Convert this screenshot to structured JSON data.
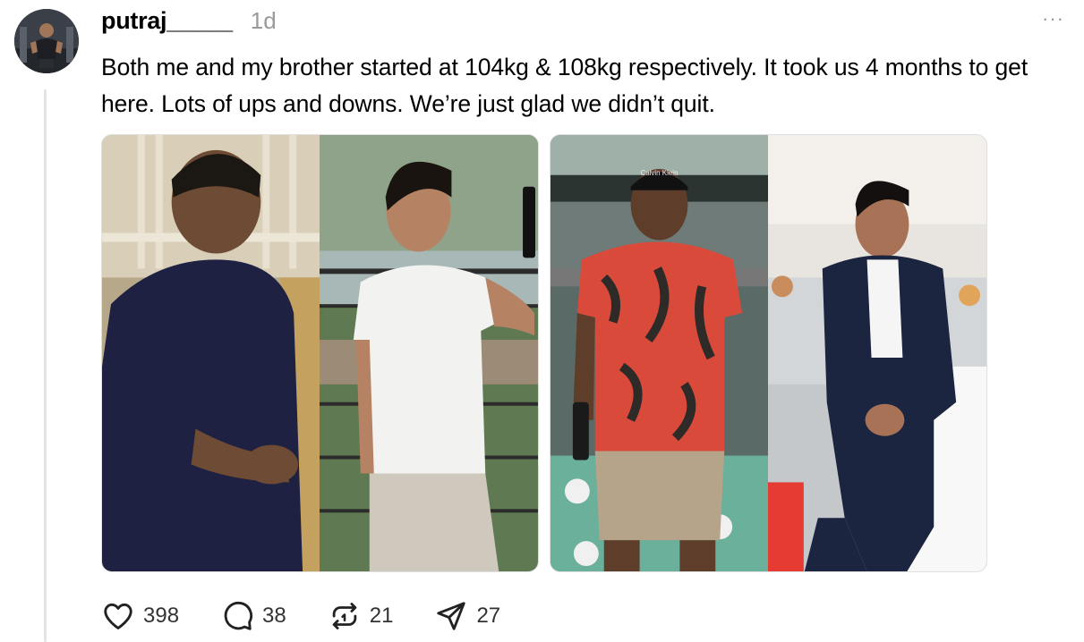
{
  "post": {
    "username": "putraj_____",
    "timestamp": "1d",
    "text": "Both me and my brother started at 104kg & 108kg respectively. It took us 4 months to get here. Lots of ups and downs. We’re just glad we didn’t quit.",
    "more_label": "···"
  },
  "photos": {
    "first": {
      "cap_text": "",
      "icon": "before-after-photo-1"
    },
    "second": {
      "cap_text": "Calvin Klein",
      "icon": "before-after-photo-2"
    }
  },
  "actions": {
    "likes": "398",
    "comments": "38",
    "reposts": "21",
    "shares": "27"
  },
  "colors": {
    "text": "#000000",
    "muted": "#9a9a9a",
    "thread_line": "#e3e3e3"
  }
}
